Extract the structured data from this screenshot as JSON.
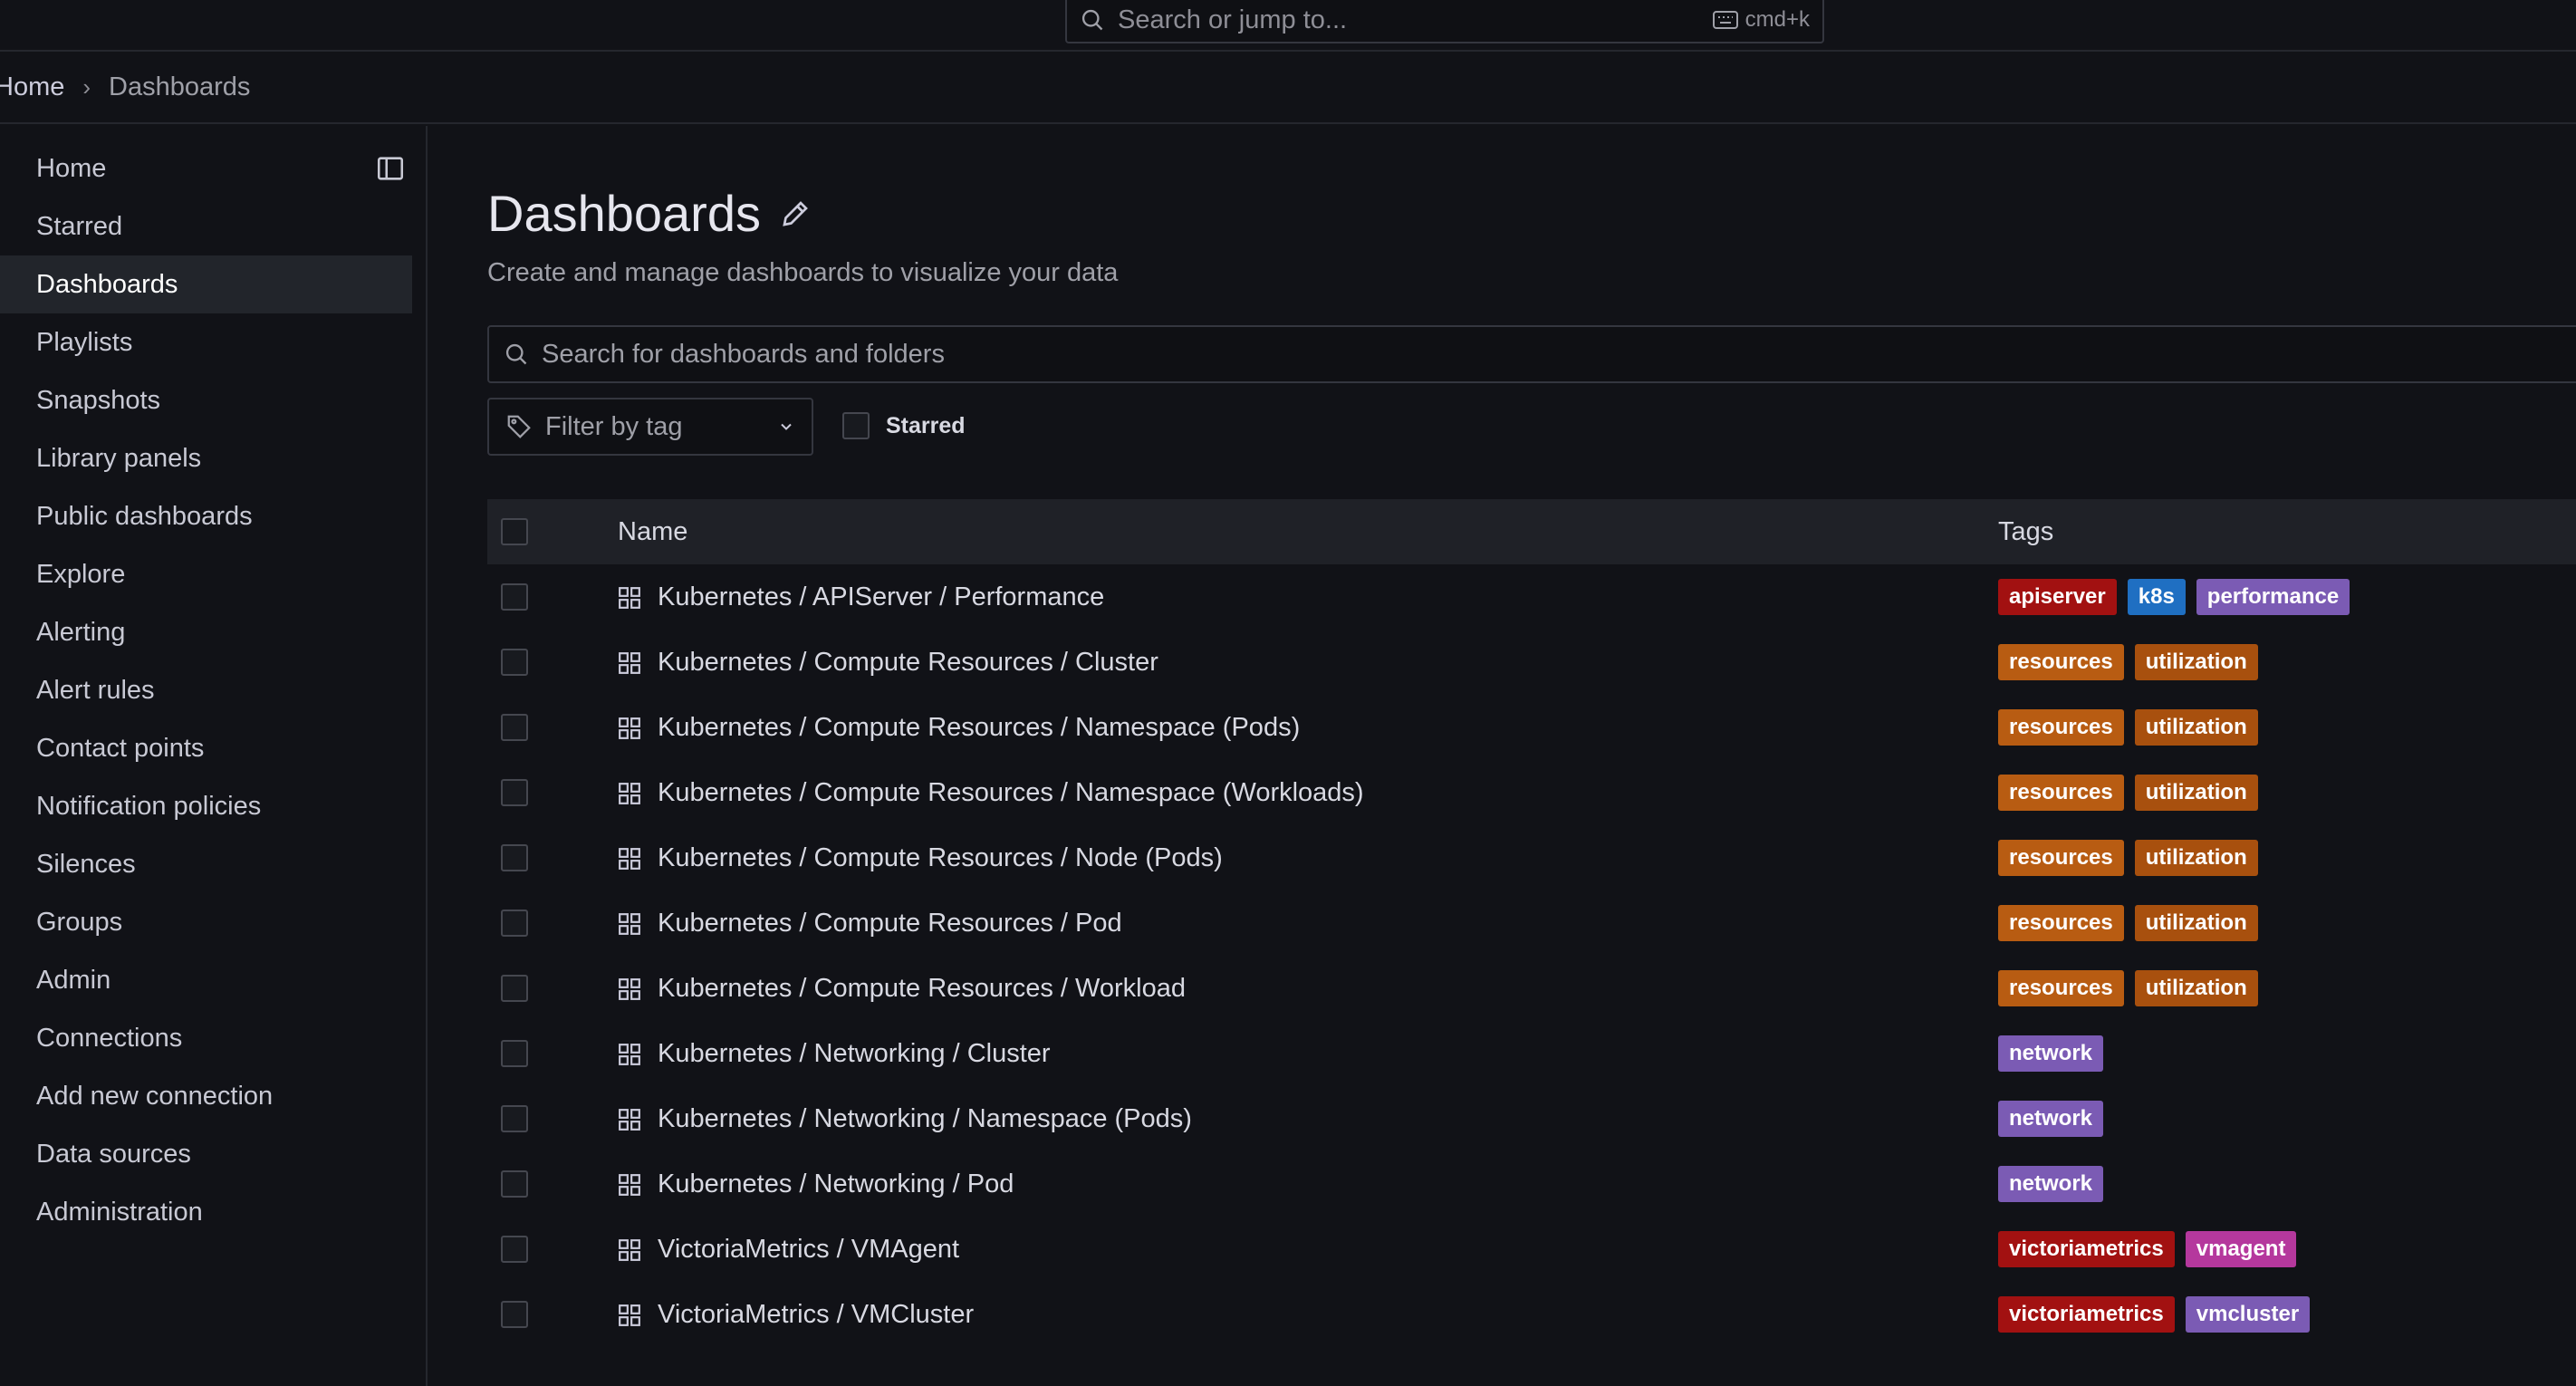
{
  "topbar": {
    "search_placeholder": "Search or jump to...",
    "shortcut": "cmd+k"
  },
  "breadcrumb": {
    "home": "Home",
    "current": "Dashboards"
  },
  "sidebar": {
    "items": [
      {
        "label": "Home",
        "active": false
      },
      {
        "label": "Starred",
        "active": false
      },
      {
        "label": "Dashboards",
        "active": true
      },
      {
        "label": "Playlists",
        "active": false
      },
      {
        "label": "Snapshots",
        "active": false
      },
      {
        "label": "Library panels",
        "active": false
      },
      {
        "label": "Public dashboards",
        "active": false
      },
      {
        "label": "Explore",
        "active": false
      },
      {
        "label": "Alerting",
        "active": false
      },
      {
        "label": "Alert rules",
        "active": false
      },
      {
        "label": "Contact points",
        "active": false
      },
      {
        "label": "Notification policies",
        "active": false
      },
      {
        "label": "Silences",
        "active": false
      },
      {
        "label": "Groups",
        "active": false
      },
      {
        "label": "Admin",
        "active": false
      },
      {
        "label": "Connections",
        "active": false
      },
      {
        "label": "Add new connection",
        "active": false
      },
      {
        "label": "Data sources",
        "active": false
      },
      {
        "label": "Administration",
        "active": false
      }
    ]
  },
  "main": {
    "title": "Dashboards",
    "subtitle": "Create and manage dashboards to visualize your data",
    "search_placeholder": "Search for dashboards and folders",
    "filter_by_tag": "Filter by tag",
    "starred_label": "Starred"
  },
  "table": {
    "headers": {
      "name": "Name",
      "tags": "Tags"
    },
    "rows": [
      {
        "name": "Kubernetes / APIServer / Performance",
        "tags": [
          {
            "label": "apiserver",
            "color": "#a21111"
          },
          {
            "label": "k8s",
            "color": "#1f6fc2"
          },
          {
            "label": "performance",
            "color": "#7b5bb4"
          }
        ]
      },
      {
        "name": "Kubernetes / Compute Resources / Cluster",
        "tags": [
          {
            "label": "resources",
            "color": "#b85c12"
          },
          {
            "label": "utilization",
            "color": "#a8500e"
          }
        ]
      },
      {
        "name": "Kubernetes / Compute Resources / Namespace (Pods)",
        "tags": [
          {
            "label": "resources",
            "color": "#b85c12"
          },
          {
            "label": "utilization",
            "color": "#a8500e"
          }
        ]
      },
      {
        "name": "Kubernetes / Compute Resources / Namespace (Workloads)",
        "tags": [
          {
            "label": "resources",
            "color": "#b85c12"
          },
          {
            "label": "utilization",
            "color": "#a8500e"
          }
        ]
      },
      {
        "name": "Kubernetes / Compute Resources / Node (Pods)",
        "tags": [
          {
            "label": "resources",
            "color": "#b85c12"
          },
          {
            "label": "utilization",
            "color": "#a8500e"
          }
        ]
      },
      {
        "name": "Kubernetes / Compute Resources / Pod",
        "tags": [
          {
            "label": "resources",
            "color": "#b85c12"
          },
          {
            "label": "utilization",
            "color": "#a8500e"
          }
        ]
      },
      {
        "name": "Kubernetes / Compute Resources / Workload",
        "tags": [
          {
            "label": "resources",
            "color": "#b85c12"
          },
          {
            "label": "utilization",
            "color": "#a8500e"
          }
        ]
      },
      {
        "name": "Kubernetes / Networking / Cluster",
        "tags": [
          {
            "label": "network",
            "color": "#7b5bb4"
          }
        ]
      },
      {
        "name": "Kubernetes / Networking / Namespace (Pods)",
        "tags": [
          {
            "label": "network",
            "color": "#7b5bb4"
          }
        ]
      },
      {
        "name": "Kubernetes / Networking / Pod",
        "tags": [
          {
            "label": "network",
            "color": "#7b5bb4"
          }
        ]
      },
      {
        "name": "VictoriaMetrics / VMAgent",
        "tags": [
          {
            "label": "victoriametrics",
            "color": "#a21111"
          },
          {
            "label": "vmagent",
            "color": "#b5389d"
          }
        ]
      },
      {
        "name": "VictoriaMetrics / VMCluster",
        "tags": [
          {
            "label": "victoriametrics",
            "color": "#a21111"
          },
          {
            "label": "vmcluster",
            "color": "#7b5bb4"
          }
        ]
      }
    ]
  }
}
